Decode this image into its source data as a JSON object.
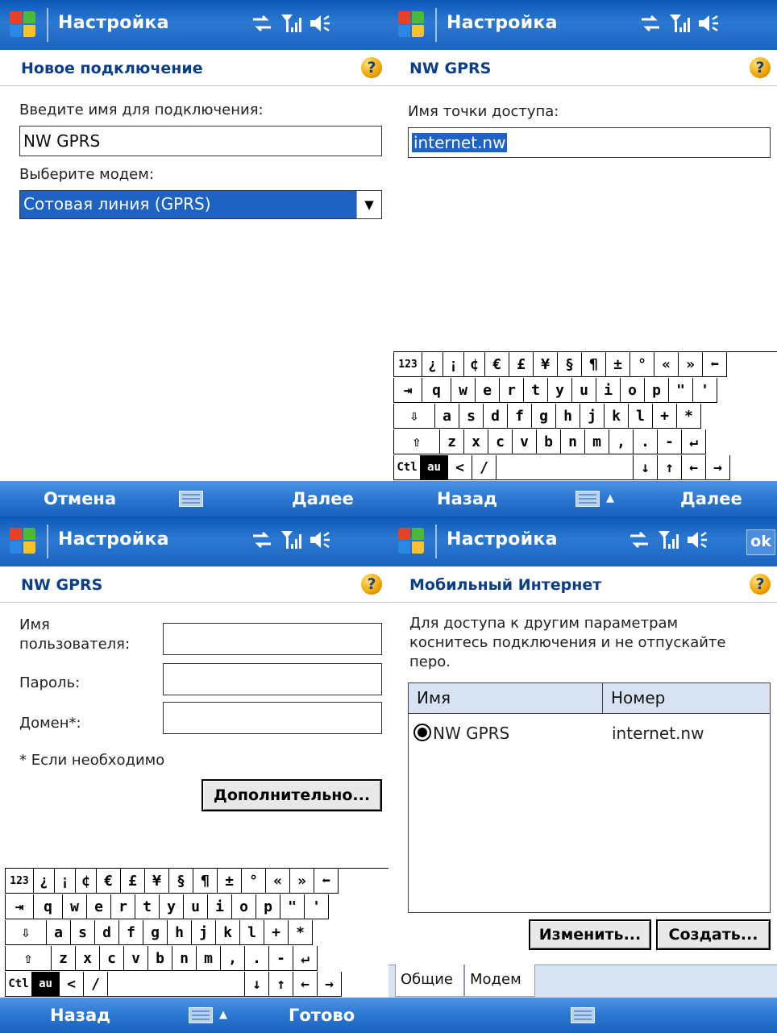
{
  "colors": {
    "titlebar": "#1a63bf",
    "selection": "#1e63c4",
    "header_text": "#0a3d8a",
    "list_header": "#d7e3f2"
  },
  "screen1": {
    "app_title": "Настройка",
    "header": "Новое подключение",
    "name_label": "Введите имя для подключения:",
    "name_value": "NW GPRS",
    "modem_label": "Выберите модем:",
    "modem_value": "Сотовая линия (GPRS)",
    "left_cmd": "Отмена",
    "right_cmd": "Далее"
  },
  "screen2": {
    "app_title": "Настройка",
    "header": "NW GPRS",
    "apn_label": "Имя точки доступа:",
    "apn_value": "internet.nw",
    "left_cmd": "Назад",
    "right_cmd": "Далее"
  },
  "screen3": {
    "app_title": "Настройка",
    "header": "NW GPRS",
    "user_label_1": "Имя",
    "user_label_2": "пользователя:",
    "password_label": "Пароль:",
    "domain_label": "Домен*:",
    "note": "* Если необходимо",
    "advanced_button": "Дополнительно...",
    "left_cmd": "Назад",
    "right_cmd": "Готово"
  },
  "screen4": {
    "app_title": "Настройка",
    "ok_label": "ok",
    "header": "Мобильный Интернет",
    "desc_1": "Для доступа к другим параметрам",
    "desc_2": "коснитесь подключения и не отпускайте",
    "desc_3": "перо.",
    "col_name": "Имя",
    "col_number": "Номер",
    "row_name": "NW GPRS",
    "row_number": "internet.nw",
    "edit_button": "Изменить...",
    "create_button": "Создать...",
    "tab_general": "Общие",
    "tab_modem": "Модем"
  },
  "keyboard": {
    "row1": [
      "123",
      "¿",
      "¡",
      "¢",
      "€",
      "£",
      "¥",
      "§",
      "¶",
      "±",
      "°",
      "«",
      "»",
      "⬅"
    ],
    "row2": [
      "⇥",
      "q",
      "w",
      "e",
      "r",
      "t",
      "y",
      "u",
      "i",
      "o",
      "p",
      "\"",
      "'"
    ],
    "row3": [
      "⇩",
      "a",
      "s",
      "d",
      "f",
      "g",
      "h",
      "j",
      "k",
      "l",
      "+",
      "*"
    ],
    "row4": [
      "⇧",
      "z",
      "x",
      "c",
      "v",
      "b",
      "n",
      "m",
      ",",
      ".",
      "-",
      "↵"
    ],
    "row5": [
      "Ctl",
      "au",
      "<",
      "/",
      "",
      "↓",
      "↑",
      "←",
      "→"
    ]
  },
  "help_symbol": "?"
}
